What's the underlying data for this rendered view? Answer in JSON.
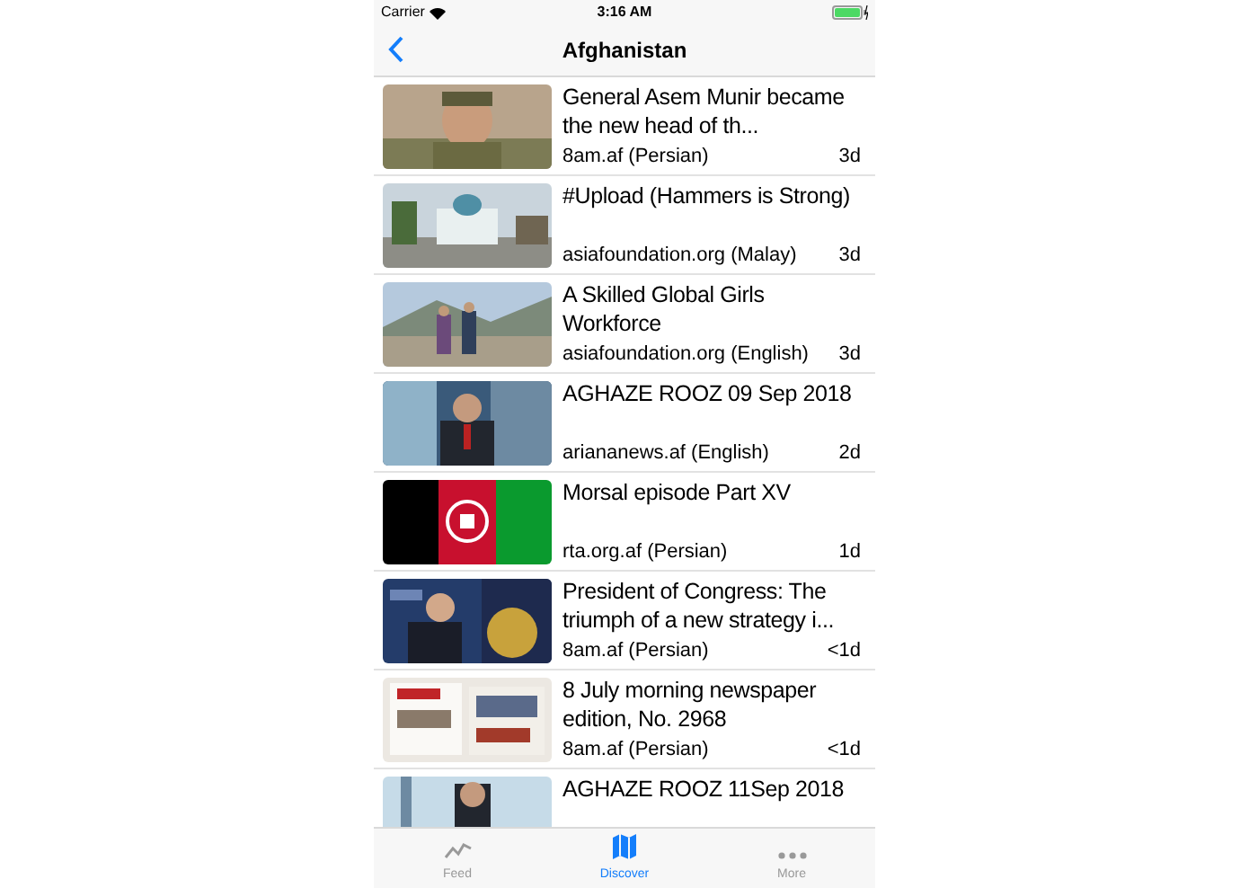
{
  "status_bar": {
    "carrier": "Carrier",
    "time": "3:16 AM"
  },
  "nav_bar": {
    "title": "Afghanistan"
  },
  "articles": [
    {
      "title": "General Asem Munir became the new head of th...",
      "source": "8am.af (Persian)",
      "age": "3d"
    },
    {
      "title": "#Upload (Hammers is Strong)",
      "source": "asiafoundation.org (Malay)",
      "age": "3d"
    },
    {
      "title": "A Skilled Global Girls Workforce",
      "source": "asiafoundation.org (English)",
      "age": "3d"
    },
    {
      "title": "AGHAZE ROOZ 09 Sep 2018",
      "source": "ariananews.af (English)",
      "age": "2d"
    },
    {
      "title": "Morsal episode Part XV",
      "source": "rta.org.af (Persian)",
      "age": "1d"
    },
    {
      "title": "President of Congress: The triumph of a new strategy i...",
      "source": "8am.af (Persian)",
      "age": "<1d"
    },
    {
      "title": "8 July morning newspaper edition, No. 2968",
      "source": "8am.af (Persian)",
      "age": "<1d"
    },
    {
      "title": "AGHAZE ROOZ 11Sep 2018"
    }
  ],
  "tab_bar": [
    {
      "label": "Feed",
      "selected": false
    },
    {
      "label": "Discover",
      "selected": true
    },
    {
      "label": "More",
      "selected": false
    }
  ]
}
